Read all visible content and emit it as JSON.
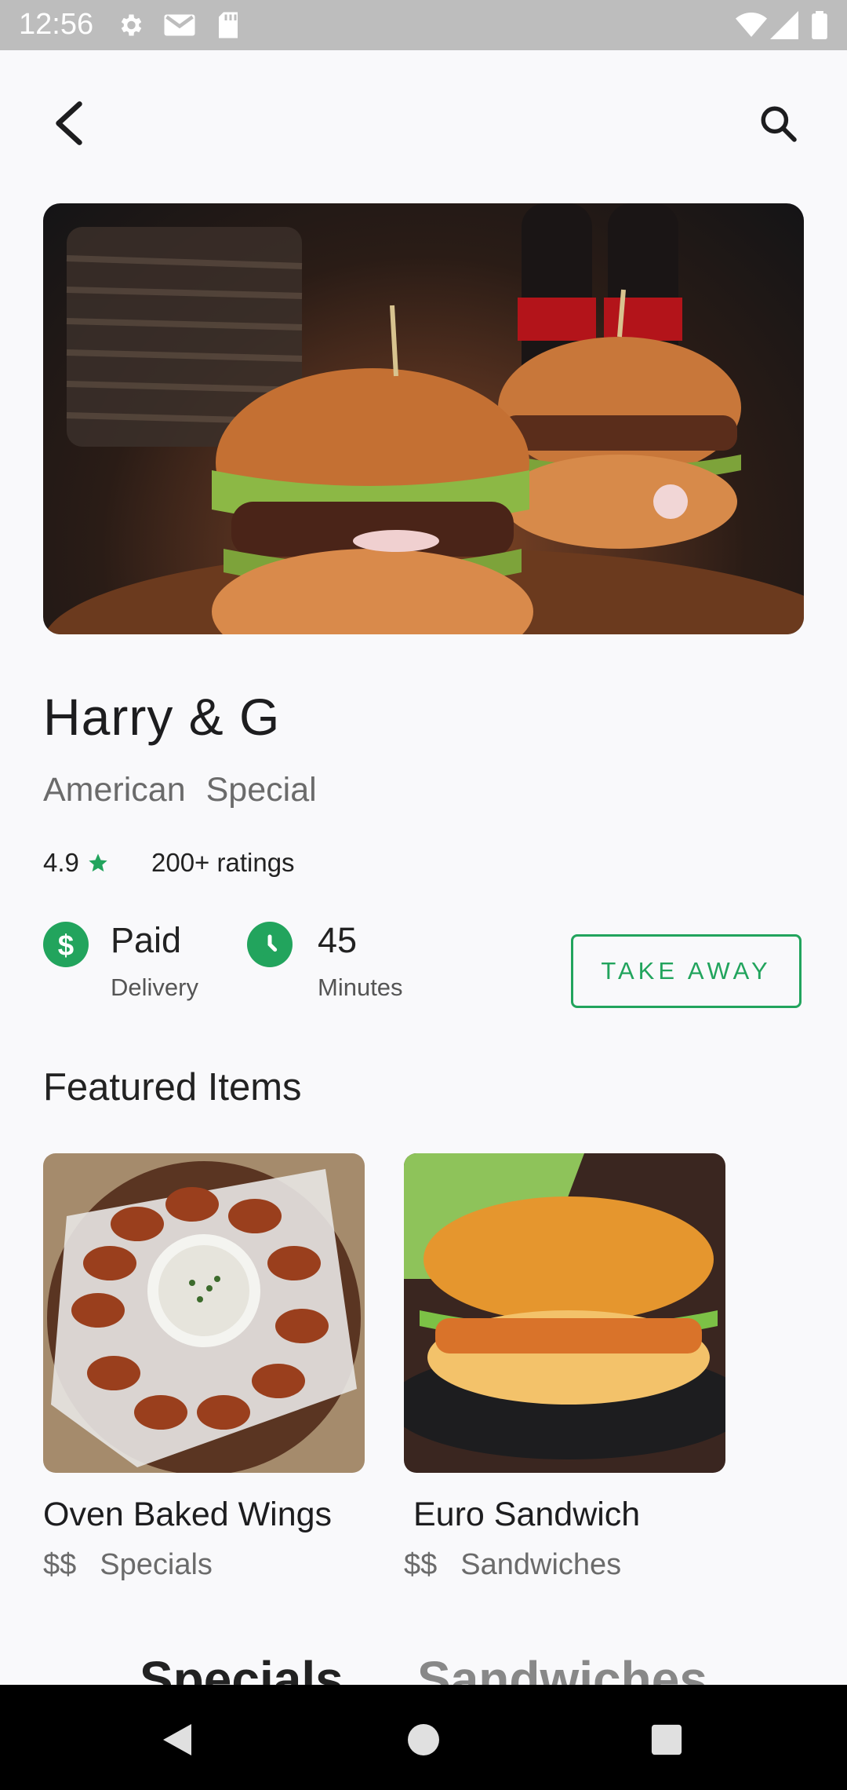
{
  "status_bar": {
    "time": "12:56",
    "icons": [
      "settings-icon",
      "gmail-icon",
      "sd-card-icon",
      "wifi-icon",
      "signal-icon",
      "battery-icon"
    ]
  },
  "top_bar": {
    "back_icon": "arrow-back-icon",
    "search_icon": "search-icon"
  },
  "restaurant": {
    "name": "Harry & G",
    "tags": [
      "American",
      "Special"
    ],
    "rating": "4.9",
    "rating_icon": "star-icon",
    "ratings_count": "200+ ratings",
    "delivery": {
      "icon": "dollar-icon",
      "value": "Paid",
      "label": "Delivery"
    },
    "time": {
      "icon": "clock-icon",
      "value": "45",
      "label": "Minutes"
    },
    "take_away_label": "TAKE AWAY"
  },
  "featured": {
    "title": "Featured Items",
    "items": [
      {
        "name": "Oven Baked Wings",
        "price": "$$",
        "category": "Specials"
      },
      {
        "name": "Euro Sandwich",
        "price": "$$",
        "category": "Sandwiches"
      }
    ]
  },
  "menu_tabs": [
    "Specials",
    "Sandwiches"
  ],
  "colors": {
    "accent": "#22a45d",
    "status_bar": "#bdbdbd",
    "nav_bar": "#000000",
    "background": "#f9f9fb"
  }
}
